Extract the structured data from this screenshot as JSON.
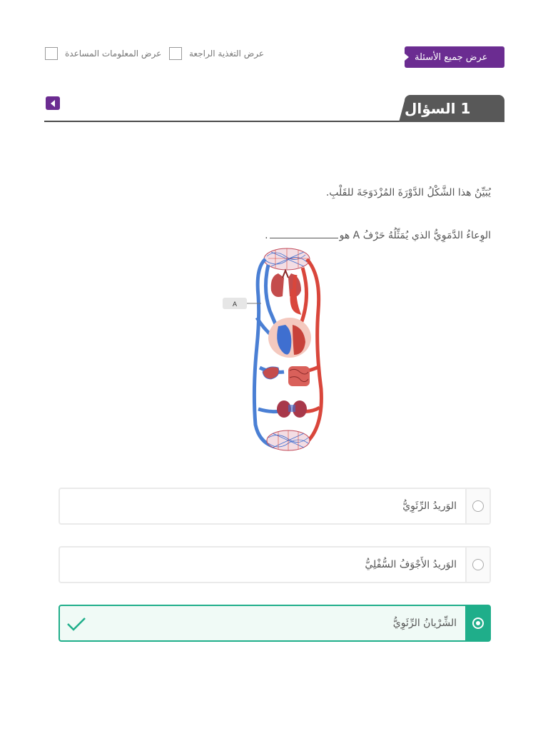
{
  "toolbar": {
    "all_questions_label": "عرض جميع الأسئلة",
    "show_feedback_label": "عرض التغذية الراجعة",
    "show_help_label": "عرض المعلومات المساعدة"
  },
  "question": {
    "title": "1 السؤال",
    "stem": "يُبَيِّنُ هذا الشَّكْلُ الدَّوْرَةَ المُزْدَوَجَةَ للقَلْبِ.",
    "prompt_before": "الوِعاءُ الدَّمَوِيُّ الذي يُمَثِّلُهُ حَرْفُ A هو",
    "prompt_after": ".",
    "diagram_label": "A"
  },
  "answers": [
    {
      "label": "الوَريدُ الرِّئَوِيُّ",
      "selected": false
    },
    {
      "label": "الوَريدُ الأَجْوَفُ السُّفْلِيُّ",
      "selected": false
    },
    {
      "label": "الشِّرْيانُ الرِّئَوِيُّ",
      "selected": true,
      "status": "correct"
    }
  ],
  "colors": {
    "accent": "#6b2c91",
    "header": "#585858",
    "correct": "#1fae8a",
    "vein_blue": "#4a7fd4",
    "artery_red": "#d9463b"
  }
}
